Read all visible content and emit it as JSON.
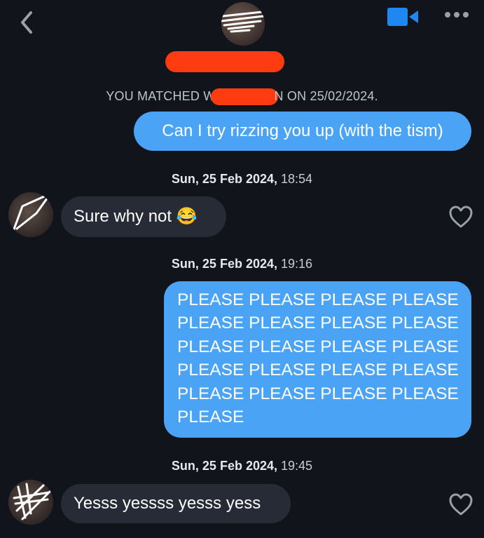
{
  "header": {
    "back_icon": "chevron-left-icon",
    "video_icon": "video-camera-icon",
    "more_icon": "ellipsis-icon"
  },
  "match_banner": {
    "prefix": "YOU MATCHED W",
    "suffix": "N ON 25/02/2024."
  },
  "messages": [
    {
      "type": "outgoing",
      "text": "Can I try rizzing you up (with the tism)"
    },
    {
      "type": "timestamp",
      "date": "Sun, 25 Feb 2024,",
      "time": "18:54"
    },
    {
      "type": "incoming",
      "text": "Sure why not 😂"
    },
    {
      "type": "timestamp",
      "date": "Sun, 25 Feb 2024,",
      "time": "19:16"
    },
    {
      "type": "outgoing",
      "lines": [
        "PLEASE PLEASE PLEASE PLEASE",
        "PLEASE PLEASE PLEASE PLEASE",
        "PLEASE PLEASE PLEASE PLEASE",
        "PLEASE PLEASE PLEASE PLEASE",
        "PLEASE PLEASE PLEASE PLEASE",
        "PLEASE"
      ]
    },
    {
      "type": "timestamp",
      "date": "Sun, 25 Feb 2024,",
      "time": "19:45"
    },
    {
      "type": "incoming",
      "text": "Yesss yessss yesss yess"
    }
  ],
  "colors": {
    "background": "#11141b",
    "outgoing_bubble": "#4aa3f5",
    "incoming_bubble": "#272b35",
    "accent": "#1e88f0",
    "redaction": "#ff3b12"
  }
}
